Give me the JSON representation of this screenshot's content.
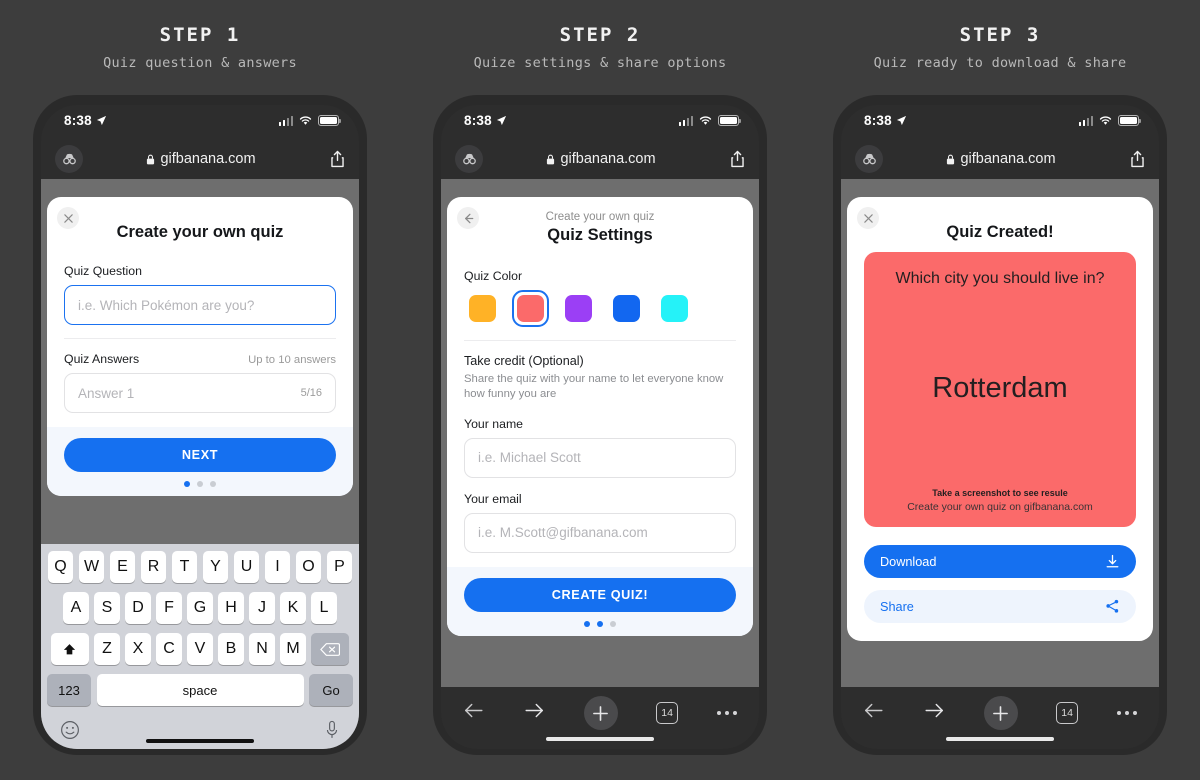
{
  "page": {
    "background": "#3d3d3d",
    "accent": "#1570f0"
  },
  "steps": [
    {
      "title": "STEP 1",
      "subtitle": "Quiz question & answers"
    },
    {
      "title": "STEP 2",
      "subtitle": "Quize settings & share options"
    },
    {
      "title": "STEP 3",
      "subtitle": "Quiz ready to download & share"
    }
  ],
  "status_bar": {
    "time": "8:38",
    "location_icon": "location-arrow-icon",
    "signal_icon": "cellular-bars-icon",
    "wifi_icon": "wifi-icon",
    "battery_icon": "battery-full-icon"
  },
  "browser": {
    "incognito_icon": "incognito-glasses-icon",
    "lock_icon": "lock-icon",
    "url": "gifbanana.com",
    "share_icon": "share-ios-icon"
  },
  "toolbar": {
    "back_icon": "arrow-left-icon",
    "forward_icon": "arrow-right-icon",
    "new_tab_icon": "plus-icon",
    "tab_count": "14",
    "more_icon": "ellipsis-icon"
  },
  "step1": {
    "close_icon": "close-x-icon",
    "title": "Create your own quiz",
    "question_label": "Quiz Question",
    "question_placeholder": "i.e. Which Pokémon are you?",
    "answers_label": "Quiz Answers",
    "answers_hint": "Up to 10 answers",
    "answer_placeholder": "Answer 1",
    "answer_counter": "5/16",
    "next_label": "NEXT",
    "active_dot": 0,
    "dot_count": 3
  },
  "step2": {
    "back_icon": "arrow-left-icon",
    "kicker": "Create your own quiz",
    "title": "Quiz Settings",
    "color_label": "Quiz Color",
    "colors": [
      {
        "name": "amber",
        "hex": "#FFB226",
        "selected": false
      },
      {
        "name": "salmon",
        "hex": "#FB6A6A",
        "selected": true
      },
      {
        "name": "purple",
        "hex": "#9B3FF5",
        "selected": false
      },
      {
        "name": "blue",
        "hex": "#1267F0",
        "selected": false
      },
      {
        "name": "cyan",
        "hex": "#25F2F8",
        "selected": false
      }
    ],
    "credit_title": "Take credit (Optional)",
    "credit_desc": "Share the quiz with your name to let everyone know how funny you are",
    "name_label": "Your name",
    "name_placeholder": "i.e. Michael Scott",
    "email_label": "Your email",
    "email_placeholder": "i.e. M.Scott@gifbanana.com",
    "cta_label": "CREATE QUIZ!",
    "active_dots": 2,
    "dot_count": 3
  },
  "step3": {
    "close_icon": "close-x-icon",
    "title": "Quiz Created!",
    "card": {
      "color": "#FB6A6A",
      "question": "Which city you should live in?",
      "answer": "Rotterdam",
      "screenshot_note": "Take a screenshot to see resule",
      "promo": "Create your own quiz on gifbanana.com"
    },
    "download_label": "Download",
    "download_icon": "download-icon",
    "share_label": "Share",
    "share_icon": "share-nodes-icon"
  },
  "keyboard": {
    "row1": [
      "Q",
      "W",
      "E",
      "R",
      "T",
      "Y",
      "U",
      "I",
      "O",
      "P"
    ],
    "row2": [
      "A",
      "S",
      "D",
      "F",
      "G",
      "H",
      "J",
      "K",
      "L"
    ],
    "row3": [
      "Z",
      "X",
      "C",
      "V",
      "B",
      "N",
      "M"
    ],
    "shift_icon": "shift-up-icon",
    "backspace_icon": "backspace-icon",
    "numeric_label": "123",
    "space_label": "space",
    "go_label": "Go",
    "emoji_icon": "emoji-smiley-icon",
    "mic_icon": "microphone-icon"
  }
}
